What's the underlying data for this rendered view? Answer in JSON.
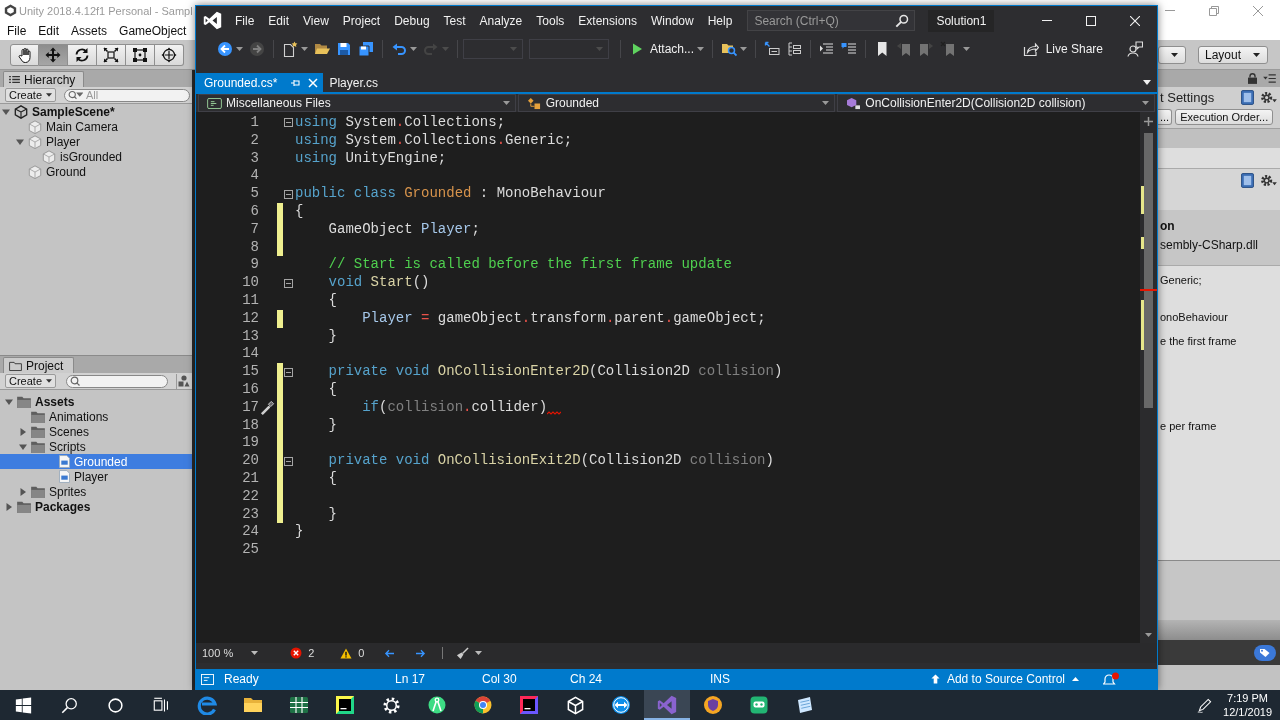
{
  "unity": {
    "title": "Unity 2018.4.12f1 Personal - Sampl",
    "menu": [
      "File",
      "Edit",
      "Assets",
      "GameObject"
    ],
    "tools": [
      {
        "kind": "hand",
        "selected": false
      },
      {
        "kind": "move",
        "selected": true
      },
      {
        "kind": "rotate",
        "selected": false
      },
      {
        "kind": "scale",
        "selected": false
      },
      {
        "kind": "rect",
        "selected": false
      },
      {
        "kind": "transform",
        "selected": false
      }
    ],
    "layout": "Layout",
    "hierarchy": {
      "tab": "Hierarchy",
      "create": "Create",
      "search_placeholder": "All",
      "tree": [
        {
          "label": "SampleScene*",
          "kind": "scene",
          "selected": false,
          "expanded": true,
          "children": [
            {
              "label": "Main Camera",
              "kind": "object",
              "selected": false
            },
            {
              "label": "Player",
              "kind": "object",
              "selected": false,
              "expanded": true,
              "children": [
                {
                  "label": "isGrounded",
                  "kind": "object",
                  "selected": false
                }
              ]
            },
            {
              "label": "Ground",
              "kind": "object",
              "selected": false
            }
          ]
        }
      ]
    },
    "project": {
      "tab": "Project",
      "create": "Create",
      "tree": [
        {
          "label": "Assets",
          "kind": "folder",
          "selected": false,
          "expanded": true,
          "children": [
            {
              "label": "Animations",
              "kind": "folder",
              "selected": false
            },
            {
              "label": "Scenes",
              "kind": "folder",
              "selected": false,
              "expanded": false
            },
            {
              "label": "Scripts",
              "kind": "folder",
              "selected": false,
              "expanded": true,
              "children": [
                {
                  "label": "Grounded",
                  "kind": "script",
                  "selected": true
                },
                {
                  "label": "Player",
                  "kind": "script",
                  "selected": false
                }
              ]
            },
            {
              "label": "Sprites",
              "kind": "folder",
              "selected": false,
              "expanded": false
            }
          ]
        },
        {
          "label": "Packages",
          "kind": "folder",
          "selected": false,
          "expanded": false
        }
      ]
    },
    "inspector": {
      "title": "t Settings",
      "buttons": [
        "...",
        "Execution Order..."
      ],
      "heading": "on",
      "subheading": "sembly-CSharp.dll",
      "preview": [
        "Generic;",
        "onoBehaviour",
        "e the first frame",
        "e per frame"
      ]
    }
  },
  "vs": {
    "menu": [
      "File",
      "Edit",
      "View",
      "Project",
      "Debug",
      "Test",
      "Analyze",
      "Tools",
      "Extensions",
      "Window",
      "Help"
    ],
    "search_placeholder": "Search (Ctrl+Q)",
    "solution": "Solution1",
    "toolbar": [
      [
        {
          "kind": "back",
          "disabled": false
        },
        {
          "kind": "forward",
          "disabled": true
        }
      ],
      [
        {
          "kind": "new_item",
          "disabled": false
        },
        {
          "kind": "open",
          "disabled": false
        },
        {
          "kind": "save",
          "disabled": false
        },
        {
          "kind": "save_all",
          "disabled": false
        }
      ],
      [
        {
          "kind": "undo",
          "disabled": false
        },
        {
          "kind": "redo",
          "disabled": true
        }
      ],
      [
        {
          "kind": "combo",
          "disabled": true
        },
        {
          "kind": "combo",
          "disabled": true
        }
      ],
      [
        {
          "kind": "attach",
          "label": "Attach...",
          "disabled": false
        }
      ],
      [
        {
          "kind": "find",
          "disabled": false
        }
      ],
      [
        {
          "kind": "step",
          "disabled": false
        },
        {
          "kind": "outline",
          "disabled": false
        }
      ],
      [
        {
          "kind": "indent",
          "disabled": false
        },
        {
          "kind": "comment",
          "disabled": false
        }
      ],
      [
        {
          "kind": "bookmark",
          "disabled": false
        },
        {
          "kind": "bookmark_prev",
          "disabled": true
        },
        {
          "kind": "bookmark_next",
          "disabled": true
        },
        {
          "kind": "bookmark_clear",
          "disabled": true
        }
      ]
    ],
    "live_share": "Live Share",
    "tabs": [
      {
        "label": "Grounded.cs*",
        "selected": true
      },
      {
        "label": "Player.cs",
        "selected": false
      }
    ],
    "nav": [
      {
        "kind": "project",
        "label": "Miscellaneous Files"
      },
      {
        "kind": "class",
        "label": "Grounded"
      },
      {
        "kind": "method",
        "label": "OnCollisionEnter2D(Collision2D collision)"
      }
    ],
    "editor": {
      "lines": [
        {
          "n": "1",
          "changed": false,
          "fold": true,
          "quick_action": false,
          "error": false,
          "tokens": [
            {
              "kind": "keyword",
              "text": "using"
            },
            {
              "kind": "plain",
              "text": " System"
            },
            {
              "kind": "operator",
              "text": "."
            },
            {
              "kind": "plain",
              "text": "Collections;"
            }
          ]
        },
        {
          "n": "2",
          "changed": false,
          "fold": false,
          "quick_action": false,
          "error": false,
          "tokens": [
            {
              "kind": "keyword",
              "text": "using"
            },
            {
              "kind": "plain",
              "text": " System"
            },
            {
              "kind": "operator",
              "text": "."
            },
            {
              "kind": "plain",
              "text": "Collections"
            },
            {
              "kind": "operator",
              "text": "."
            },
            {
              "kind": "plain",
              "text": "Generic;"
            }
          ]
        },
        {
          "n": "3",
          "changed": false,
          "fold": false,
          "quick_action": false,
          "error": false,
          "tokens": [
            {
              "kind": "keyword",
              "text": "using"
            },
            {
              "kind": "plain",
              "text": " UnityEngine;"
            }
          ]
        },
        {
          "n": "4",
          "changed": false,
          "fold": false,
          "quick_action": false,
          "error": false
        },
        {
          "n": "5",
          "changed": false,
          "fold": true,
          "quick_action": false,
          "error": false,
          "tokens": [
            {
              "kind": "keyword",
              "text": "public class "
            },
            {
              "kind": "class",
              "text": "Grounded"
            },
            {
              "kind": "plain",
              "text": " : MonoBehaviour"
            }
          ]
        },
        {
          "n": "6",
          "changed": true,
          "fold": false,
          "quick_action": false,
          "error": false,
          "tokens": [
            {
              "kind": "plain",
              "text": "{"
            }
          ]
        },
        {
          "n": "7",
          "changed": true,
          "fold": false,
          "quick_action": false,
          "error": false,
          "tokens": [
            {
              "kind": "plain",
              "text": "    GameObject "
            },
            {
              "kind": "field",
              "text": "Player"
            },
            {
              "kind": "plain",
              "text": ";"
            }
          ]
        },
        {
          "n": "8",
          "changed": true,
          "fold": false,
          "quick_action": false,
          "error": false
        },
        {
          "n": "9",
          "changed": false,
          "fold": false,
          "quick_action": false,
          "error": false,
          "tokens": [
            {
              "kind": "comment",
              "text": "    // Start is called before the first frame update"
            }
          ]
        },
        {
          "n": "10",
          "changed": false,
          "fold": true,
          "quick_action": false,
          "error": false,
          "tokens": [
            {
              "kind": "keyword",
              "text": "    void "
            },
            {
              "kind": "method",
              "text": "Start"
            },
            {
              "kind": "plain",
              "text": "()"
            }
          ]
        },
        {
          "n": "11",
          "changed": false,
          "fold": false,
          "quick_action": false,
          "error": false,
          "tokens": [
            {
              "kind": "plain",
              "text": "    {"
            }
          ]
        },
        {
          "n": "12",
          "changed": true,
          "fold": false,
          "quick_action": false,
          "error": false,
          "tokens": [
            {
              "kind": "field",
              "text": "        Player"
            },
            {
              "kind": "operator",
              "text": " = "
            },
            {
              "kind": "plain",
              "text": "gameObject"
            },
            {
              "kind": "operator",
              "text": "."
            },
            {
              "kind": "plain",
              "text": "transform"
            },
            {
              "kind": "operator",
              "text": "."
            },
            {
              "kind": "plain",
              "text": "parent"
            },
            {
              "kind": "operator",
              "text": "."
            },
            {
              "kind": "plain",
              "text": "gameObject;"
            }
          ]
        },
        {
          "n": "13",
          "changed": false,
          "fold": false,
          "quick_action": false,
          "error": false,
          "tokens": [
            {
              "kind": "plain",
              "text": "    }"
            }
          ]
        },
        {
          "n": "14",
          "changed": false,
          "fold": false,
          "quick_action": false,
          "error": false
        },
        {
          "n": "15",
          "changed": true,
          "fold": true,
          "quick_action": false,
          "error": false,
          "tokens": [
            {
              "kind": "keyword",
              "text": "    private void "
            },
            {
              "kind": "method",
              "text": "OnCollisionEnter2D"
            },
            {
              "kind": "plain",
              "text": "(Collision2D "
            },
            {
              "kind": "param",
              "text": "collision"
            },
            {
              "kind": "plain",
              "text": ")"
            }
          ]
        },
        {
          "n": "16",
          "changed": true,
          "fold": false,
          "quick_action": false,
          "error": false,
          "tokens": [
            {
              "kind": "plain",
              "text": "    {"
            }
          ]
        },
        {
          "n": "17",
          "changed": true,
          "fold": false,
          "quick_action": true,
          "error": true,
          "tokens": [
            {
              "kind": "keyword",
              "text": "        if"
            },
            {
              "kind": "plain",
              "text": "("
            },
            {
              "kind": "param",
              "text": "collision"
            },
            {
              "kind": "operator",
              "text": "."
            },
            {
              "kind": "plain",
              "text": "collider)"
            }
          ]
        },
        {
          "n": "18",
          "changed": true,
          "fold": false,
          "quick_action": false,
          "error": false,
          "tokens": [
            {
              "kind": "plain",
              "text": "    }"
            }
          ]
        },
        {
          "n": "19",
          "changed": true,
          "fold": false,
          "quick_action": false,
          "error": false
        },
        {
          "n": "20",
          "changed": true,
          "fold": true,
          "quick_action": false,
          "error": false,
          "tokens": [
            {
              "kind": "keyword",
              "text": "    private void "
            },
            {
              "kind": "method",
              "text": "OnCollisionExit2D"
            },
            {
              "kind": "plain",
              "text": "(Collision2D "
            },
            {
              "kind": "param",
              "text": "collision"
            },
            {
              "kind": "plain",
              "text": ")"
            }
          ]
        },
        {
          "n": "21",
          "changed": true,
          "fold": false,
          "quick_action": false,
          "error": false,
          "tokens": [
            {
              "kind": "plain",
              "text": "    {"
            }
          ]
        },
        {
          "n": "22",
          "changed": true,
          "fold": false,
          "quick_action": false,
          "error": false
        },
        {
          "n": "23",
          "changed": true,
          "fold": false,
          "quick_action": false,
          "error": false,
          "tokens": [
            {
              "kind": "plain",
              "text": "    }"
            }
          ]
        },
        {
          "n": "24",
          "changed": false,
          "fold": false,
          "quick_action": false,
          "error": false,
          "tokens": [
            {
              "kind": "plain",
              "text": "}"
            }
          ]
        },
        {
          "n": "25",
          "changed": false,
          "fold": false,
          "quick_action": false,
          "error": false
        }
      ]
    },
    "zoom": "100 %",
    "errors": "2",
    "warnings": "0",
    "status": {
      "message": "Ready",
      "line": "Ln 17",
      "column": "Col 30",
      "char": "Ch 24",
      "mode": "INS",
      "source_control": "Add to Source Control"
    }
  },
  "taskbar": {
    "apps": [
      {
        "kind": "start",
        "active": false
      },
      {
        "kind": "search",
        "active": false
      },
      {
        "kind": "assistant",
        "active": false
      },
      {
        "kind": "task_view",
        "active": false
      },
      {
        "kind": "swirl",
        "active": false
      },
      {
        "kind": "folder",
        "active": false
      },
      {
        "kind": "spreadsheet",
        "active": false
      },
      {
        "kind": "tile",
        "active": false
      },
      {
        "kind": "gear",
        "active": false
      },
      {
        "kind": "compass",
        "active": false
      },
      {
        "kind": "wheel",
        "active": false
      },
      {
        "kind": "square",
        "active": false
      },
      {
        "kind": "cube",
        "active": false
      },
      {
        "kind": "arrows",
        "active": false
      },
      {
        "kind": "ribbon",
        "active": true
      },
      {
        "kind": "shield",
        "active": false
      },
      {
        "kind": "robot",
        "active": false
      },
      {
        "kind": "note",
        "active": false
      }
    ],
    "time": "7:19 PM",
    "date": "12/1/2019"
  }
}
